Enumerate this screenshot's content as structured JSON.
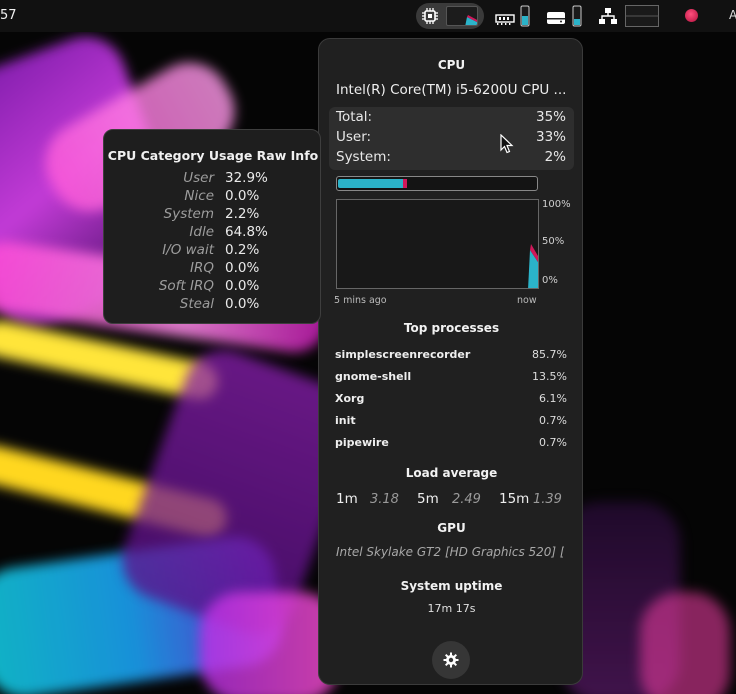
{
  "topbar": {
    "clock": "57",
    "right_letter": "A",
    "icons": [
      "cpu-icon",
      "memory-icon",
      "storage-icon",
      "network-icon",
      "recorder-icon"
    ]
  },
  "panel": {
    "title": "CPU",
    "cpu_model": "Intel(R) Core(TM) i5-6200U CPU ...",
    "usage": [
      {
        "label": "Total:",
        "value": "35%"
      },
      {
        "label": "User:",
        "value": "33%"
      },
      {
        "label": "System:",
        "value": "2%"
      }
    ],
    "usage_fractions": {
      "user": 0.33,
      "system": 0.02
    },
    "graph": {
      "y_labels": [
        "100%",
        "50%",
        "0%"
      ],
      "x_labels": [
        "5 mins ago",
        "now"
      ]
    },
    "top_processes_title": "Top processes",
    "processes": [
      {
        "name": "simplescreenrecorder",
        "value": "85.7%"
      },
      {
        "name": "gnome-shell",
        "value": "13.5%"
      },
      {
        "name": "Xorg",
        "value": "6.1%"
      },
      {
        "name": "init",
        "value": "0.7%"
      },
      {
        "name": "pipewire",
        "value": "0.7%"
      }
    ],
    "load_title": "Load average",
    "load": [
      {
        "label": "1m",
        "value": "3.18"
      },
      {
        "label": "5m",
        "value": "2.49"
      },
      {
        "label": "15m",
        "value": "1.39"
      }
    ],
    "gpu_title": "GPU",
    "gpu_name": "Intel Skylake GT2 [HD Graphics 520] [...",
    "uptime_title": "System uptime",
    "uptime": "17m 17s"
  },
  "tooltip": {
    "title": "CPU Category Usage Raw Info",
    "rows": [
      {
        "label": "User",
        "value": "32.9%"
      },
      {
        "label": "Nice",
        "value": "0.0%"
      },
      {
        "label": "System",
        "value": "2.2%"
      },
      {
        "label": "Idle",
        "value": "64.8%"
      },
      {
        "label": "I/O wait",
        "value": "0.2%"
      },
      {
        "label": "IRQ",
        "value": "0.0%"
      },
      {
        "label": "Soft IRQ",
        "value": "0.0%"
      },
      {
        "label": "Steal",
        "value": "0.0%"
      }
    ]
  },
  "colors": {
    "user": "#2bb3c9",
    "system": "#d0185a",
    "accent_rec": "#e0245e"
  }
}
